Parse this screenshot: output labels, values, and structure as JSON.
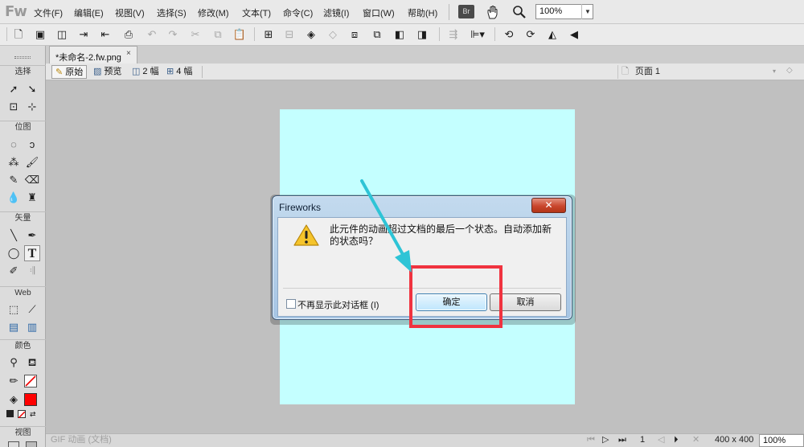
{
  "app": {
    "logo": "Fw"
  },
  "menus": [
    "文件(F)",
    "编辑(E)",
    "视图(V)",
    "选择(S)",
    "修改(M)",
    "文本(T)",
    "命令(C)",
    "滤镜(I)",
    "窗口(W)",
    "帮助(H)"
  ],
  "bridge_badge": "Br",
  "zoom": {
    "value": "100%"
  },
  "tools": {
    "sections": [
      "选择",
      "位图",
      "矢量",
      "Web",
      "颜色",
      "视图"
    ],
    "colors": {
      "fill": "#ff0000",
      "stroke": "#222222"
    }
  },
  "document": {
    "tab_title": "*未命名-2.fw.png",
    "canvas_color": "#c4ffff",
    "views": [
      "原始",
      "预览",
      "2 幅",
      "4 幅"
    ],
    "page": "页面 1"
  },
  "status": {
    "left": "GIF 动画 (文档)",
    "frame": "1",
    "size": "400 x 400",
    "zoom": "100%"
  },
  "dialog": {
    "title": "Fireworks",
    "message": "此元件的动画超过文档的最后一个状态。自动添加新的状态吗？",
    "checkbox_label": "不再显示此对话框 (I)",
    "ok": "确定",
    "cancel": "取消"
  },
  "annotation": {
    "highlight_color": "#f0333f",
    "arrow_color": "#2ec4d6"
  }
}
